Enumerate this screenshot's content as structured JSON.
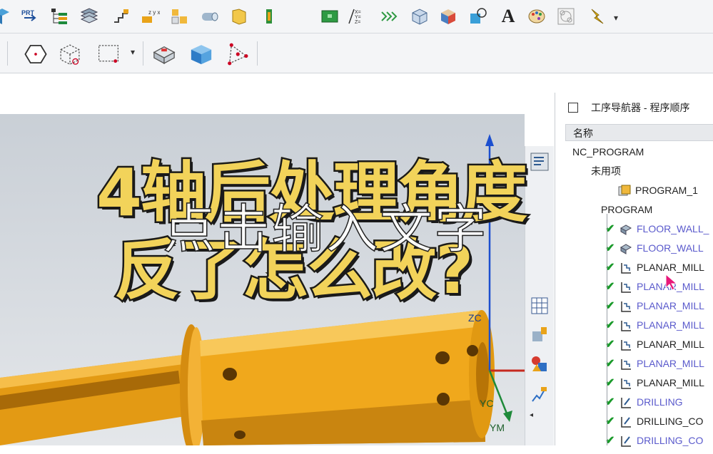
{
  "toolbar_top": {
    "icons": [
      "cube-icon",
      "prt-icon",
      "tree-icon",
      "layers-icon",
      "steps-icon",
      "xyz-coords-icon",
      "blocks-icon",
      "cylinder-icon",
      "face-icon",
      "drill-icon",
      "rectangle-icon",
      "equation-icon",
      "lines-icon",
      "box-icon",
      "color-cube-icon",
      "transform-icon",
      "text-icon",
      "palette-icon",
      "circles-icon",
      "lightning-icon"
    ],
    "prt_label": "PRT",
    "text_glyph": "A",
    "more_arrow": "▾"
  },
  "toolbar_bottom": {
    "icons": [
      "hexagon-icon",
      "wire-cube-icon",
      "selection-box-icon",
      "solid-block-icon",
      "blue-cube-icon",
      "triangle-nodes-icon"
    ],
    "dropdown_arrow": "▾"
  },
  "navigator": {
    "title": "工序导航器 - 程序顺序",
    "column_header": "名称",
    "rows": [
      {
        "label": "NC_PROGRAM",
        "check": "",
        "color": "#222",
        "x": 14,
        "icon": "none"
      },
      {
        "label": "未用项",
        "check": "",
        "color": "#222",
        "x": 40,
        "icon": "none"
      },
      {
        "label": "PROGRAM_1",
        "check": "",
        "color": "#222",
        "x": 68,
        "icon": "program-icon"
      },
      {
        "label": "PROGRAM",
        "check": "",
        "color": "#222",
        "x": 54,
        "icon": "none"
      },
      {
        "label": "FLOOR_WALL_",
        "check": "✔",
        "color": "#5a5acc",
        "x": 70,
        "icon": "floor-wall-icon"
      },
      {
        "label": "FLOOR_WALL",
        "check": "✔",
        "color": "#5a5acc",
        "x": 70,
        "icon": "floor-wall-icon"
      },
      {
        "label": "PLANAR_MILL",
        "check": "✔",
        "color": "#222",
        "x": 70,
        "icon": "planar-mill-icon"
      },
      {
        "label": "PLANAR_MILL",
        "check": "✔",
        "color": "#5a5acc",
        "x": 70,
        "icon": "planar-mill-icon"
      },
      {
        "label": "PLANAR_MILL",
        "check": "✔",
        "color": "#5a5acc",
        "x": 70,
        "icon": "planar-mill-icon"
      },
      {
        "label": "PLANAR_MILL",
        "check": "✔",
        "color": "#5a5acc",
        "x": 70,
        "icon": "planar-mill-icon"
      },
      {
        "label": "PLANAR_MILL",
        "check": "✔",
        "color": "#222",
        "x": 70,
        "icon": "planar-mill-icon"
      },
      {
        "label": "PLANAR_MILL",
        "check": "✔",
        "color": "#5a5acc",
        "x": 70,
        "icon": "planar-mill-icon"
      },
      {
        "label": "PLANAR_MILL",
        "check": "✔",
        "color": "#222",
        "x": 70,
        "icon": "planar-mill-icon"
      },
      {
        "label": "DRILLING",
        "check": "✔",
        "color": "#5a5acc",
        "x": 70,
        "icon": "drilling-icon"
      },
      {
        "label": "DRILLING_CO",
        "check": "✔",
        "color": "#222",
        "x": 70,
        "icon": "drilling-icon"
      },
      {
        "label": "DRILLING_CO",
        "check": "✔",
        "color": "#5a5acc",
        "x": 70,
        "icon": "drilling-icon"
      }
    ]
  },
  "viewport": {
    "axis_zc": "ZC",
    "axis_yc": "YC",
    "axis_ym": "YM"
  },
  "overlay": {
    "title_line1": "4轴后处理角度",
    "title_line2": "反了怎么改?",
    "hint_text": "点击输入文字"
  },
  "colors": {
    "part_orange": "#f0a81c",
    "check_green": "#1a9a2a",
    "link_purple": "#5a5acc"
  }
}
